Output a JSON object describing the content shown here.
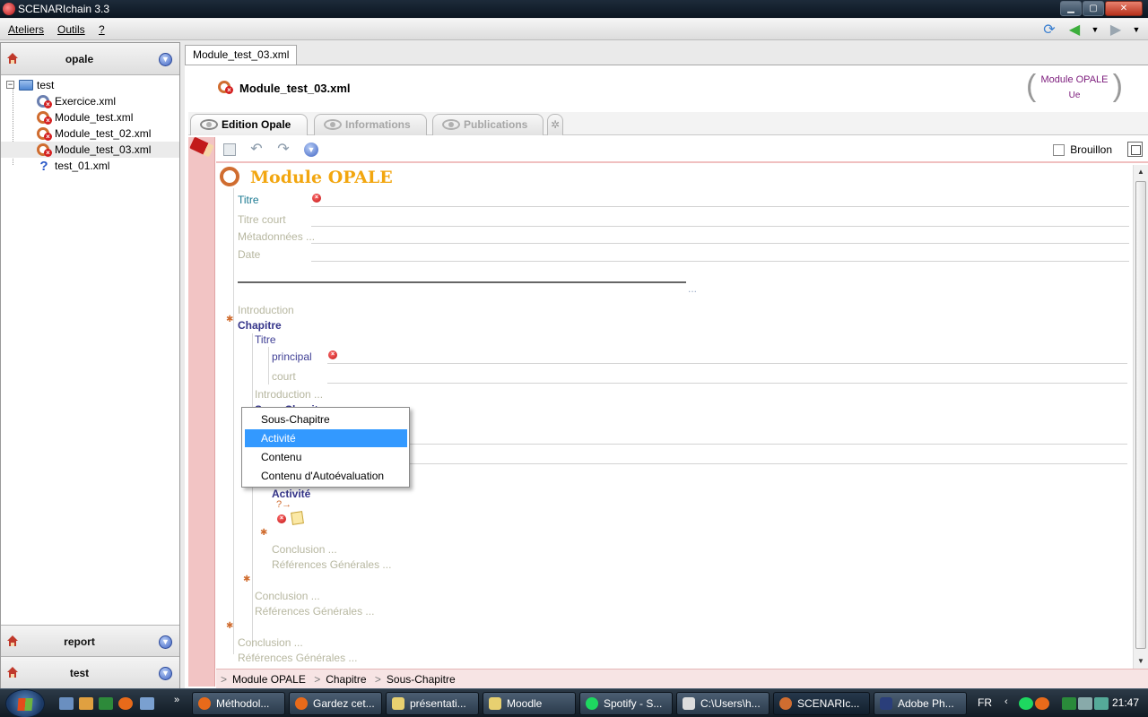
{
  "window": {
    "title": "SCENARIchain 3.3",
    "min": "▁",
    "max": "▢",
    "close": "✕"
  },
  "menu": {
    "items": [
      "Ateliers",
      "Outils",
      "?"
    ]
  },
  "sidebar": {
    "workspaces": [
      {
        "name": "opale"
      },
      {
        "name": "report"
      },
      {
        "name": "test"
      }
    ],
    "tree": {
      "root": "test",
      "items": [
        "Exercice.xml",
        "Module_test.xml",
        "Module_test_02.xml",
        "Module_test_03.xml",
        "test_01.xml"
      ]
    }
  },
  "doc": {
    "tab_label": "Module_test_03.xml",
    "title": "Module_test_03.xml",
    "model": {
      "name": "Module OPALE",
      "sub": "Ue"
    },
    "view_tabs": [
      "Edition Opale",
      "Informations",
      "Publications"
    ],
    "brouillon_label": "Brouillon"
  },
  "editor": {
    "module_title": "Module OPALE",
    "fields": {
      "titre": "Titre",
      "titre_court": "Titre court",
      "metadonnees": "Métadonnées ...",
      "date": "Date",
      "ellipsis": "...",
      "introduction": "Introduction",
      "chapitre": "Chapitre",
      "chap_titre": "Titre",
      "principal": "principal",
      "court": "court",
      "chap_introduction": "Introduction ...",
      "sous_chapitre": "Sous-Chapitre",
      "activite": "Activité",
      "conclusion_inner": "Conclusion ...",
      "references_inner": "Références Générales ...",
      "conclusion_mid": "Conclusion ...",
      "references_mid": "Références Générales ...",
      "conclusion_outer": "Conclusion ...",
      "references_outer": "Références Générales ..."
    }
  },
  "context_menu": {
    "items": [
      "Sous-Chapitre",
      "Activité",
      "Contenu",
      "Contenu d'Autoévaluation"
    ],
    "highlighted": "Activité"
  },
  "breadcrumb": [
    "Module OPALE",
    "Chapitre",
    "Sous-Chapitre"
  ],
  "taskbar": {
    "buttons": [
      "Méthodol...",
      "Gardez cet...",
      "présentati...",
      "Moodle",
      "Spotify - S...",
      "C:\\Users\\h...",
      "SCENARIc...",
      "Adobe Ph..."
    ],
    "lang": "FR",
    "clock": "21:47"
  }
}
